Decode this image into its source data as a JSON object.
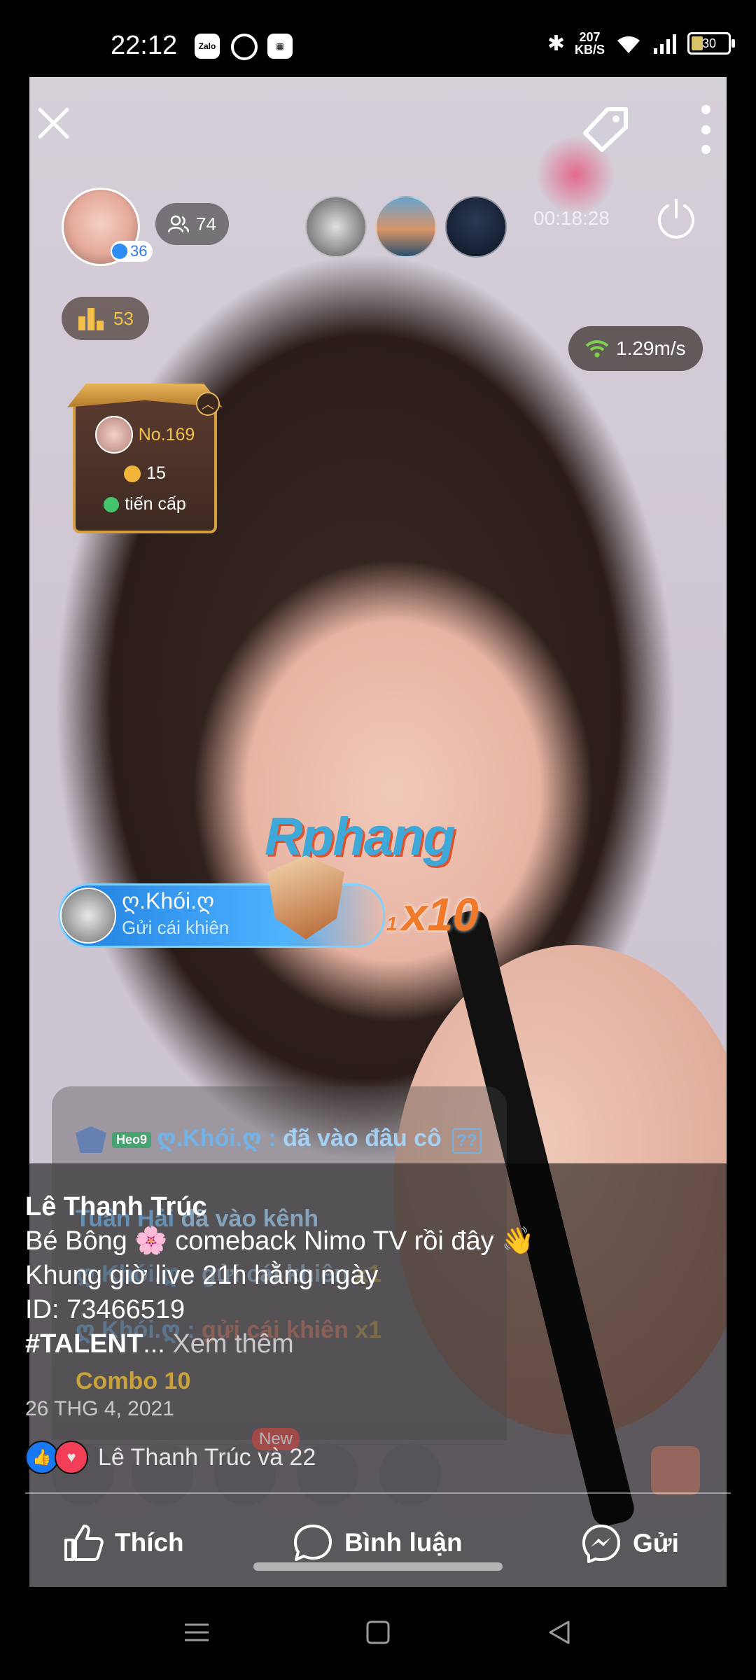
{
  "status_bar": {
    "time": "22:12",
    "app_icons": [
      "zalo-icon",
      "sync-icon",
      "grid-app-icon"
    ],
    "net_speed_value": "207",
    "net_speed_unit": "KB/S",
    "battery": "30"
  },
  "stream": {
    "host_level": "36",
    "viewer_count": "74",
    "timer": "00:18:28",
    "fans_count": "53",
    "net_speed": "1.29m/s",
    "rank_card": {
      "rank": "No.169",
      "coins": "15",
      "upgrade_label": "tiến cấp"
    },
    "gift": {
      "sender": "ღ.Khói.ღ",
      "message": "Gửi cái khiên",
      "multiplier_small": "1",
      "multiplier": "x10"
    },
    "watermark": "Rphang",
    "chat": [
      {
        "user": "ღ.Khói.ღ :",
        "badge": "Heo9",
        "text": "đã vào đâu cô",
        "suffix": "??"
      },
      {
        "user": "Tuấn Hải",
        "text": "đã vào kênh"
      },
      {
        "user": "ღ.Khói.ღ :",
        "text": "gửi cái khiên",
        "suffix": "x1"
      },
      {
        "user": "ღ.Khói.ღ :",
        "text": "gửi cái khiên",
        "suffix": "x1"
      }
    ],
    "combo": "Combo 10",
    "new_badge": "New"
  },
  "post": {
    "author": "Lê Thanh Trúc",
    "lines": [
      "Bé Bông 🌸 comeback Nimo TV rồi đây 👋",
      "Khung giờ live 21h hằng ngày",
      "ID: 73466519"
    ],
    "hashtag": "#TALENT",
    "ellipsis": "...",
    "see_more": "Xem thêm",
    "date": "26 THG 4, 2021",
    "reactions_text": "Lê Thanh Trúc và 22"
  },
  "actions": {
    "like": "Thích",
    "comment": "Bình luận",
    "send": "Gửi"
  },
  "colors": {
    "facebook_blue": "#1877f2",
    "love_red": "#f33e58",
    "gift_banner": "#1f7fe0",
    "fans_gold": "#f3c04b"
  }
}
